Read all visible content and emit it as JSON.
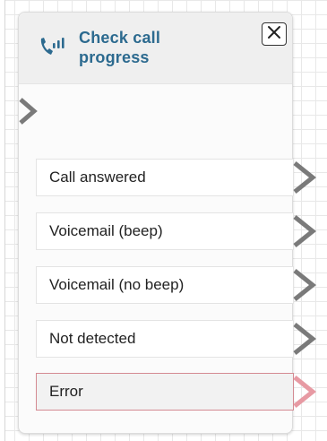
{
  "block": {
    "title": "Check call progress",
    "icon": "phone-call-icon",
    "close_icon": "close-icon"
  },
  "branches": [
    {
      "label": "Call answered",
      "status": "normal"
    },
    {
      "label": "Voicemail (beep)",
      "status": "normal"
    },
    {
      "label": "Voicemail (no beep)",
      "status": "normal"
    },
    {
      "label": "Not detected",
      "status": "normal"
    },
    {
      "label": "Error",
      "status": "error"
    }
  ],
  "colors": {
    "title": "#2c6a8f",
    "connector": "#7a7a7a",
    "error_connector": "#e79aa3",
    "error_border": "#d48a92"
  }
}
